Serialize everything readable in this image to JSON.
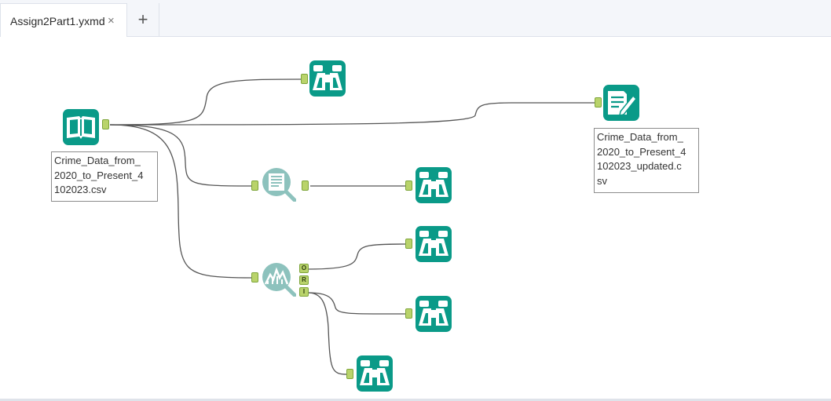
{
  "tabs": [
    {
      "label": "Assign2Part1.yxmd",
      "close_glyph": "×",
      "active": true
    }
  ],
  "new_tab_glyph": "+",
  "colors": {
    "tool_primary": "#0a9a88",
    "tool_secondary": "#8dc2bd",
    "anchor_fill": "#b9d36b",
    "wire": "#555555"
  },
  "workflow": {
    "tools": [
      {
        "id": "input",
        "type": "input-data",
        "icon": "open-book-icon"
      },
      {
        "id": "browse-1",
        "type": "browse",
        "icon": "binoculars-icon"
      },
      {
        "id": "output",
        "type": "output-data",
        "icon": "document-pen-icon"
      },
      {
        "id": "basic-profile",
        "type": "basic-data-profile",
        "icon": "profile-magnifier-icon"
      },
      {
        "id": "browse-2",
        "type": "browse",
        "icon": "binoculars-icon"
      },
      {
        "id": "data-investigation",
        "type": "data-investigation",
        "icon": "chart-magnifier-icon"
      },
      {
        "id": "browse-3",
        "type": "browse",
        "icon": "binoculars-icon"
      },
      {
        "id": "browse-4",
        "type": "browse",
        "icon": "binoculars-icon"
      },
      {
        "id": "browse-5",
        "type": "browse",
        "icon": "binoculars-icon"
      }
    ],
    "anchor_labels": {
      "o": "O",
      "r": "R",
      "i": "I"
    },
    "annotations": {
      "input": "Crime_Data_from_\n2020_to_Present_4\n102023.csv",
      "output": "Crime_Data_from_\n2020_to_Present_4\n102023_updated.c\nsv"
    }
  }
}
